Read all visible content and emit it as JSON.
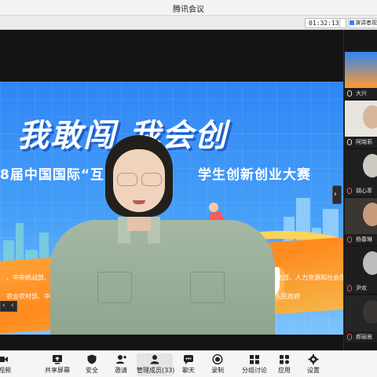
{
  "window": {
    "title": "腾讯会议"
  },
  "top_bar": {
    "timer": "01:32:13",
    "speaker_view_label": "演讲者视"
  },
  "slide": {
    "slogan": "我敢闯 我会创",
    "subtitle_left": "8届中国国际“互",
    "subtitle_right": "学生创新创业大赛",
    "footer_line1_left": "、中央统战部、中央",
    "footer_line1_right": "信息化部、人力资源和社会保障部、",
    "footer_line2_left": "农业农村部、中国科",
    "footer_line2_right": "市人民政府"
  },
  "participants": [
    {
      "name": "大兴",
      "mic": "on",
      "active": true
    },
    {
      "name": "阿晓莉",
      "mic": "on",
      "active": false
    },
    {
      "name": "胡心萃",
      "mic": "off",
      "active": false
    },
    {
      "name": "杨春琳",
      "mic": "off",
      "active": false
    },
    {
      "name": "尹欢",
      "mic": "off",
      "active": false
    },
    {
      "name": "郝丽嵩",
      "mic": "off",
      "active": false
    }
  ],
  "toolbar": {
    "video_label": "视频",
    "share_label": "共享屏幕",
    "security_label": "安全",
    "invite_label": "邀请",
    "members_label": "管理成员(33)",
    "chat_label": "聊天",
    "record_label": "录制",
    "breakout_label": "分组讨论",
    "apps_label": "应用",
    "settings_label": "设置"
  },
  "colors": {
    "accent": "#2e7cf6",
    "slide_blue": "#2f86f5",
    "slide_orange": "#ff8a1e",
    "mic_muted": "#ff4d4d"
  }
}
